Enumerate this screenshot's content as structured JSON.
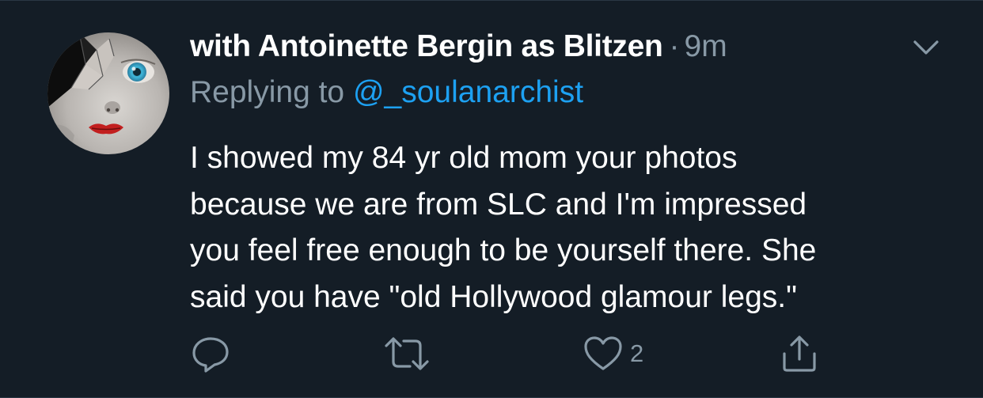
{
  "tweet": {
    "display_name": "with Antoinette Bergin as Blitzen",
    "separator": "·",
    "timestamp": "9m",
    "replying_prefix": "Replying to ",
    "replying_handle": "@_soulanarchist",
    "body_lines": [
      "I showed my 84 yr old mom your photos",
      "because we are from SLC and I'm impressed",
      "you feel free enough to be yourself there. She",
      "said you have \"old Hollywood glamour legs.\""
    ]
  },
  "actions": {
    "reply_icon": "reply-icon",
    "retweet_icon": "retweet-icon",
    "like_icon": "heart-icon",
    "like_count": "2",
    "share_icon": "share-icon"
  },
  "colors": {
    "background": "#141d26",
    "text_primary": "#ffffff",
    "text_secondary": "#8899a6",
    "link": "#1da1f2"
  }
}
